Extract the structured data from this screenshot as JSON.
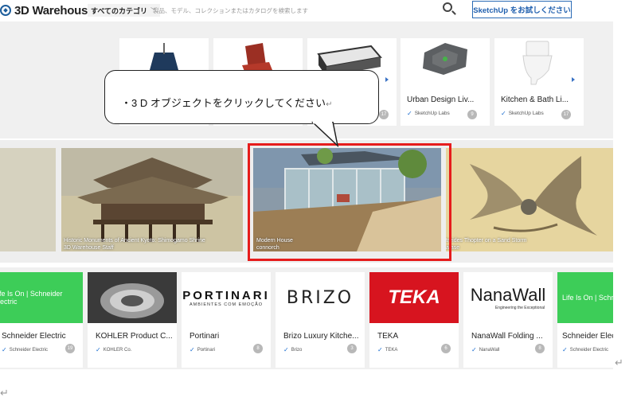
{
  "header": {
    "logo_text": "3D Warehouse",
    "category_label": "すべてのカテゴリ",
    "search_placeholder": "製品、モデル、コレクションまたはカタログを検索します",
    "try_button": "SketchUp をお試しください"
  },
  "models": [
    {
      "title": "",
      "author": "",
      "badge": ""
    },
    {
      "title": "",
      "author": "",
      "badge": ""
    },
    {
      "title": "",
      "author": "",
      "badge": "17"
    },
    {
      "title": "Urban Design Liv...",
      "author": "SketchUp Labs",
      "badge": "9"
    },
    {
      "title": "Kitchen & Bath Li...",
      "author": "SketchUp Labs",
      "badge": "17"
    }
  ],
  "featured": [
    {
      "title": "",
      "author": ""
    },
    {
      "title": "Historic Monuments of Ancient Kyoto: Shimogamo Shrine",
      "author": "3D Warehouse Staff"
    },
    {
      "title": "Modern House",
      "author": "connorch"
    },
    {
      "title": "treides  Thopter on a Sand Storm",
      "author": "atase"
    }
  ],
  "brands": [
    {
      "name": "Schneider Electric",
      "author": "Schneider Electric",
      "badge": "19",
      "logo": "Life Is On | Schneider Electric"
    },
    {
      "name": "KOHLER Product C...",
      "author": "KOHLER Co.",
      "badge": "",
      "logo": ""
    },
    {
      "name": "Portinari",
      "author": "Portinari",
      "badge": "8",
      "logo": "PORTINARI",
      "logo_sub": "AMBIENTES COM EMOÇÃO"
    },
    {
      "name": "Brizo Luxury Kitche...",
      "author": "Brizo",
      "badge": "3",
      "logo": "BRIZO"
    },
    {
      "name": "TEKA",
      "author": "TEKA",
      "badge": "6",
      "logo": "TEKA"
    },
    {
      "name": "NanaWall Folding ...",
      "author": "NanaWall",
      "badge": "8",
      "logo": "NanaWall",
      "logo_sub": "Engineering the Exceptional"
    },
    {
      "name": "Schneider Elec",
      "author": "Schneider Electric",
      "badge": "",
      "logo": "Life Is On | Schneider"
    }
  ],
  "callout": {
    "text": "・3 D オブジェクトをクリックしてください",
    "return_mark": "↵"
  },
  "marks": {
    "return_right": "↵",
    "return_bottom": "↵"
  },
  "colors": {
    "accent_blue": "#1f5fae",
    "highlight_red": "#e61c1c",
    "schneider_green": "#3dcd58",
    "teka_red": "#d7141f"
  }
}
